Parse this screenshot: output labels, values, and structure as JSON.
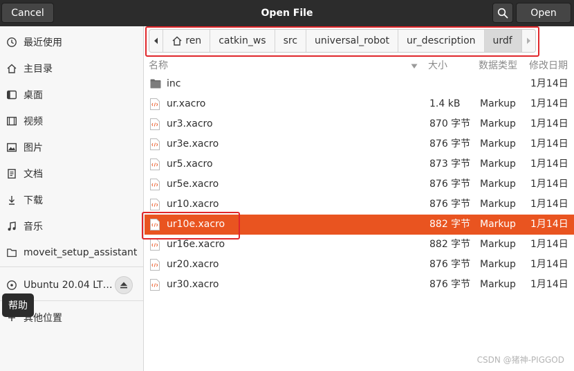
{
  "header": {
    "cancel_label": "Cancel",
    "title": "Open File",
    "open_label": "Open",
    "search_icon": "search-icon"
  },
  "sidebar": {
    "items": [
      {
        "label": "最近使用",
        "icon": "recent-icon"
      },
      {
        "label": "主目录",
        "icon": "home-icon"
      },
      {
        "label": "桌面",
        "icon": "desktop-icon"
      },
      {
        "label": "视频",
        "icon": "video-icon"
      },
      {
        "label": "图片",
        "icon": "picture-icon"
      },
      {
        "label": "文档",
        "icon": "document-icon"
      },
      {
        "label": "下载",
        "icon": "download-icon"
      },
      {
        "label": "音乐",
        "icon": "music-icon"
      },
      {
        "label": "moveit_setup_assistant",
        "icon": "folder-icon"
      },
      {
        "label": "Ubuntu 20.04 LT…",
        "icon": "disk-icon"
      },
      {
        "label": "其他位置",
        "icon": "plus-icon"
      }
    ],
    "tooltip": "帮助"
  },
  "pathbar": {
    "crumbs": [
      "ren",
      "catkin_ws",
      "src",
      "universal_robot",
      "ur_description",
      "urdf"
    ],
    "active_index": 5
  },
  "columns": {
    "name": "名称",
    "size": "大小",
    "type": "数据类型",
    "modified": "修改日期"
  },
  "files": [
    {
      "name": "inc",
      "size": "",
      "type": "",
      "modified": "1月14日",
      "kind": "folder"
    },
    {
      "name": "ur.xacro",
      "size": "1.4 kB",
      "type": "Markup",
      "modified": "1月14日",
      "kind": "file"
    },
    {
      "name": "ur3.xacro",
      "size": "870 字节",
      "type": "Markup",
      "modified": "1月14日",
      "kind": "file"
    },
    {
      "name": "ur3e.xacro",
      "size": "876 字节",
      "type": "Markup",
      "modified": "1月14日",
      "kind": "file"
    },
    {
      "name": "ur5.xacro",
      "size": "873 字节",
      "type": "Markup",
      "modified": "1月14日",
      "kind": "file"
    },
    {
      "name": "ur5e.xacro",
      "size": "876 字节",
      "type": "Markup",
      "modified": "1月14日",
      "kind": "file"
    },
    {
      "name": "ur10.xacro",
      "size": "876 字节",
      "type": "Markup",
      "modified": "1月14日",
      "kind": "file"
    },
    {
      "name": "ur10e.xacro",
      "size": "882 字节",
      "type": "Markup",
      "modified": "1月14日",
      "kind": "file",
      "selected": true
    },
    {
      "name": "ur16e.xacro",
      "size": "882 字节",
      "type": "Markup",
      "modified": "1月14日",
      "kind": "file"
    },
    {
      "name": "ur20.xacro",
      "size": "876 字节",
      "type": "Markup",
      "modified": "1月14日",
      "kind": "file"
    },
    {
      "name": "ur30.xacro",
      "size": "876 字节",
      "type": "Markup",
      "modified": "1月14日",
      "kind": "file"
    }
  ],
  "watermark": "CSDN @猪神-PIGGOD",
  "colors": {
    "accent": "#e95420",
    "annotation": "#e0262a",
    "headerbar": "#2c2c2c"
  }
}
